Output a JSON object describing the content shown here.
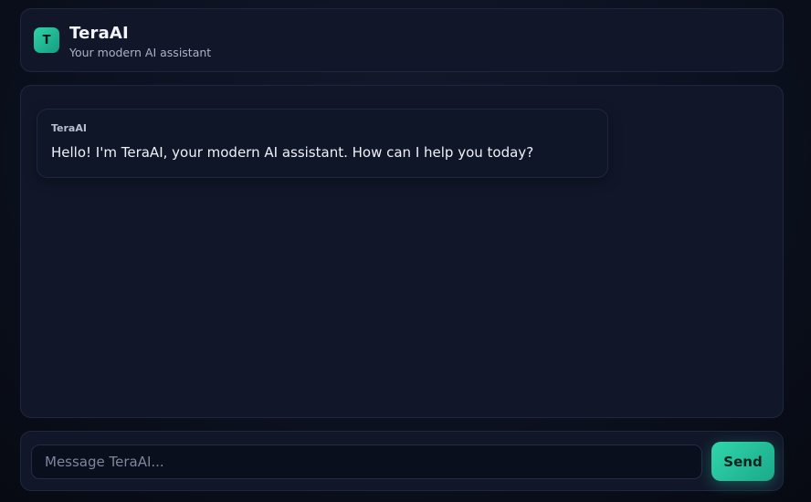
{
  "header": {
    "logo_letter": "T",
    "title": "TeraAI",
    "subtitle": "Your modern AI assistant"
  },
  "chat": {
    "messages": [
      {
        "sender": "TeraAI",
        "text": "Hello! I'm TeraAI, your modern AI assistant. How can I help you today?"
      }
    ]
  },
  "composer": {
    "placeholder": "Message TeraAI...",
    "value": "",
    "send_label": "Send"
  },
  "colors": {
    "accent": "#2fd3a8",
    "background": "#0c1120",
    "panel": "#111729"
  }
}
